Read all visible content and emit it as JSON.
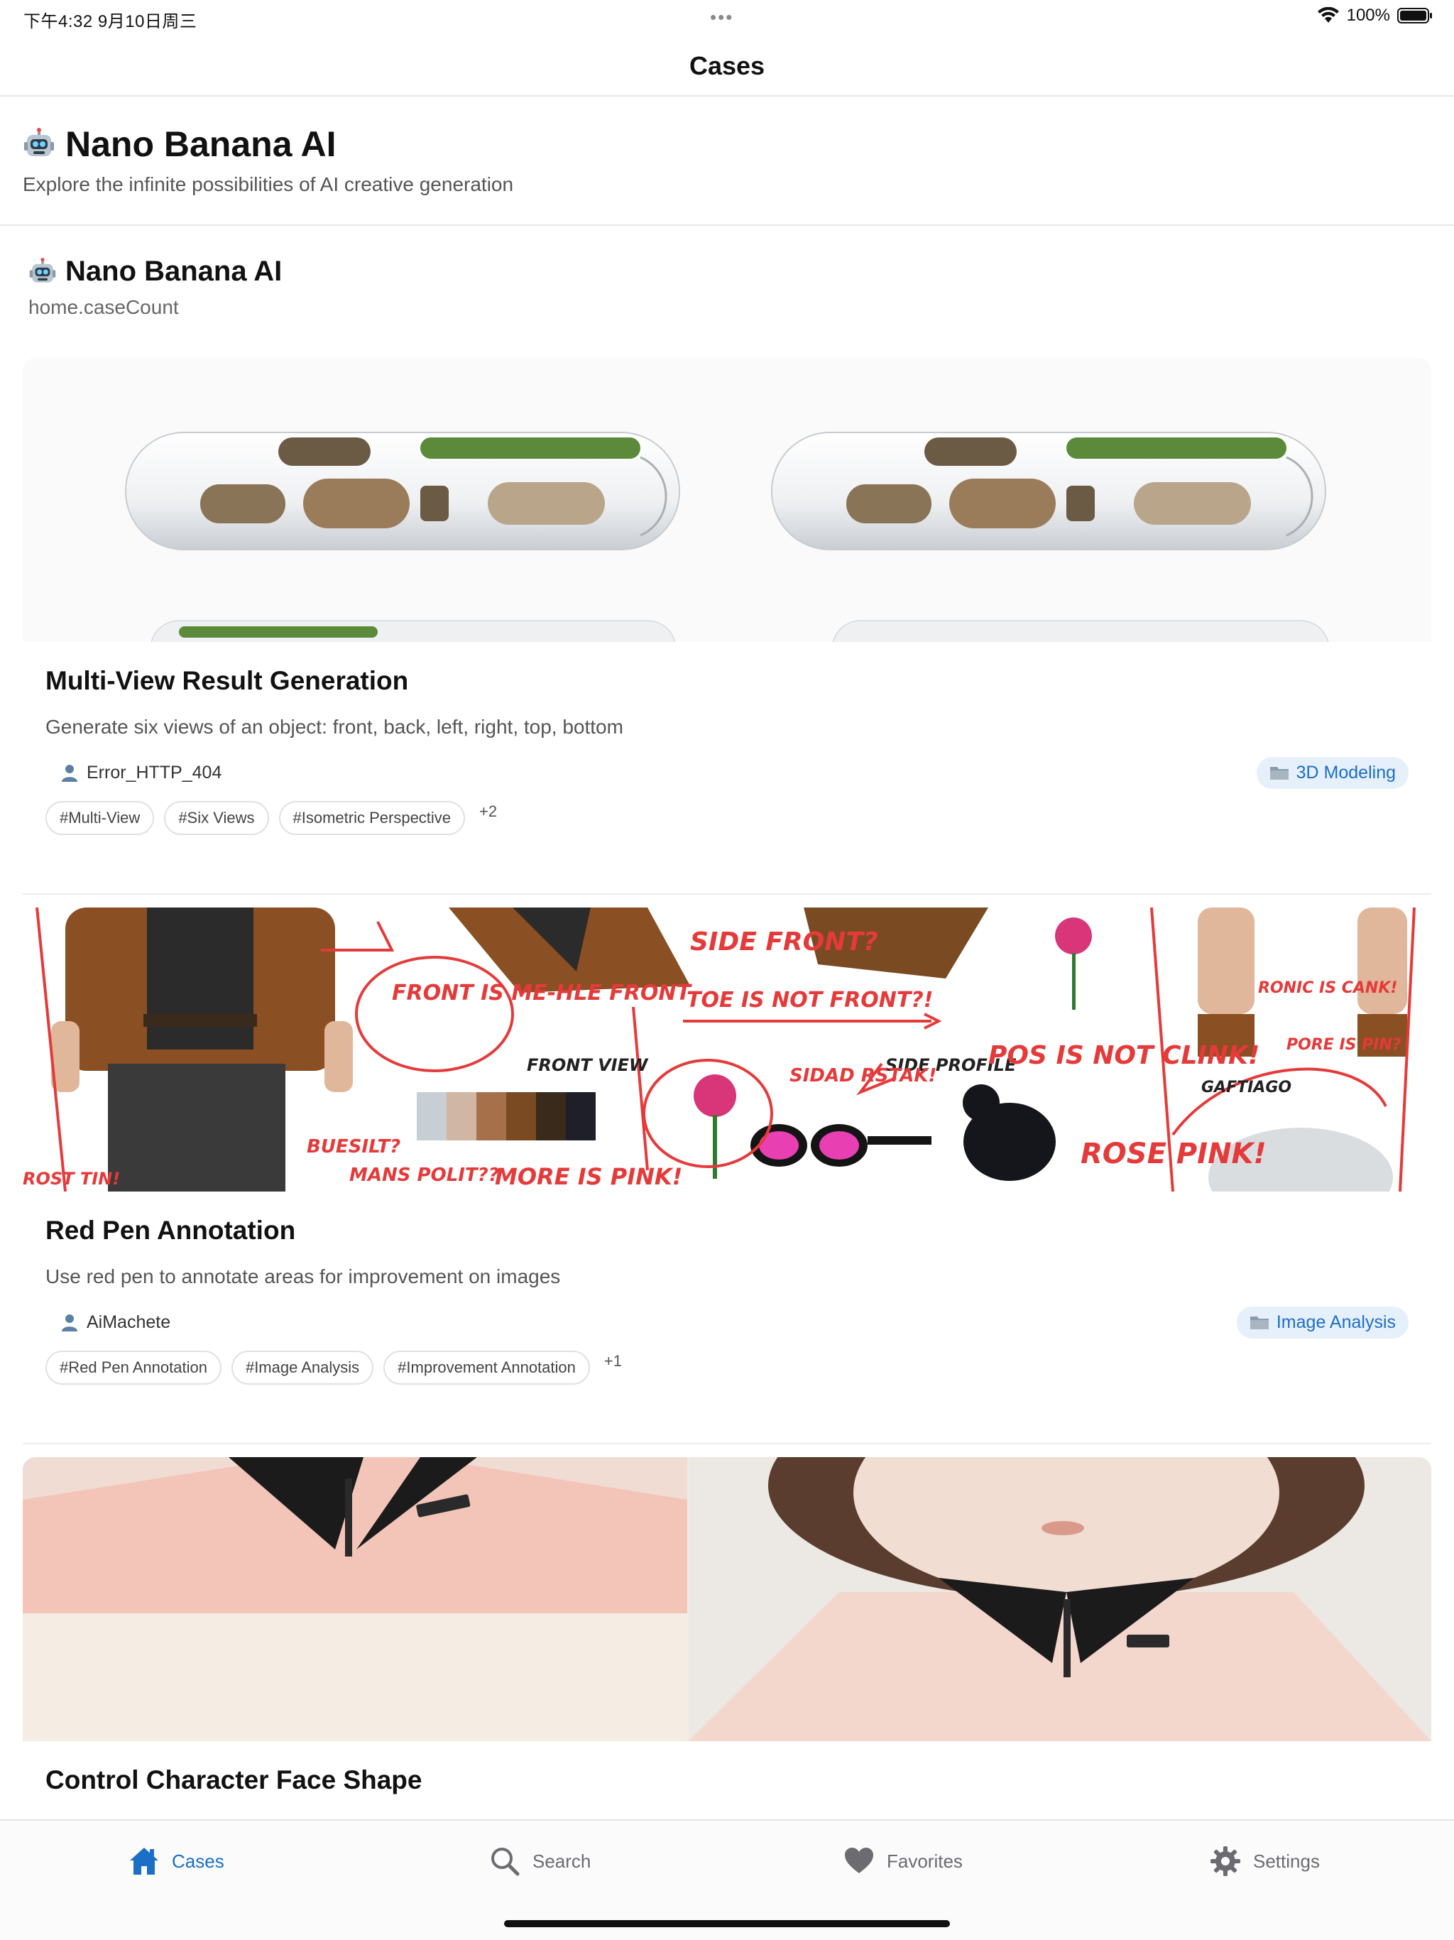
{
  "status_bar": {
    "time": "下午4:32   9月10日周三",
    "dots": "•••",
    "battery": "100%"
  },
  "nav": {
    "title": "Cases"
  },
  "hero": {
    "title": "Nano Banana AI",
    "subtitle": "Explore the infinite possibilities of AI creative generation"
  },
  "section": {
    "title": "Nano Banana AI",
    "count_label": "home.caseCount"
  },
  "cards": [
    {
      "title": "Multi-View Result Generation",
      "description": "Generate six views of an object: front, back, left, right, top, bottom",
      "author": "Error_HTTP_404",
      "category": "3D Modeling",
      "tags": [
        "#Multi-View",
        "#Six Views",
        "#Isometric Perspective"
      ],
      "more": "+2"
    },
    {
      "title": "Red Pen Annotation",
      "description": "Use red pen to annotate areas for improvement on images",
      "author": "AiMachete",
      "category": "Image Analysis",
      "tags": [
        "#Red Pen Annotation",
        "#Image Analysis",
        "#Improvement Annotation"
      ],
      "more": "+1",
      "image_text": {
        "a": "FRONT IS ME-HLE FRONT",
        "b": "FRONT VIEW",
        "c": "SIDE FRONT?",
        "d": "TOE IS NOT FRONT?!",
        "e": "SIDE PROFILE",
        "f": "POS IS NOT CLINK!",
        "g": "ROSE PINK!",
        "h": "GAFTIAGO",
        "i": "MORE IS PINK!",
        "j": "MANS POLIT??",
        "k": "BUESILT?",
        "l": "SIDAD RSTAK!",
        "m": "ROST TIN!",
        "n": "RONIC IS CANK!",
        "o": "PORE IS PIN?"
      }
    },
    {
      "title": "Control Character Face Shape"
    }
  ],
  "tabs": {
    "cases": "Cases",
    "search": "Search",
    "favorites": "Favorites",
    "settings": "Settings"
  },
  "colors": {
    "accent": "#1c6fc7",
    "badge_bg": "#e6f0fb",
    "annotation_red": "#e53a3a"
  }
}
